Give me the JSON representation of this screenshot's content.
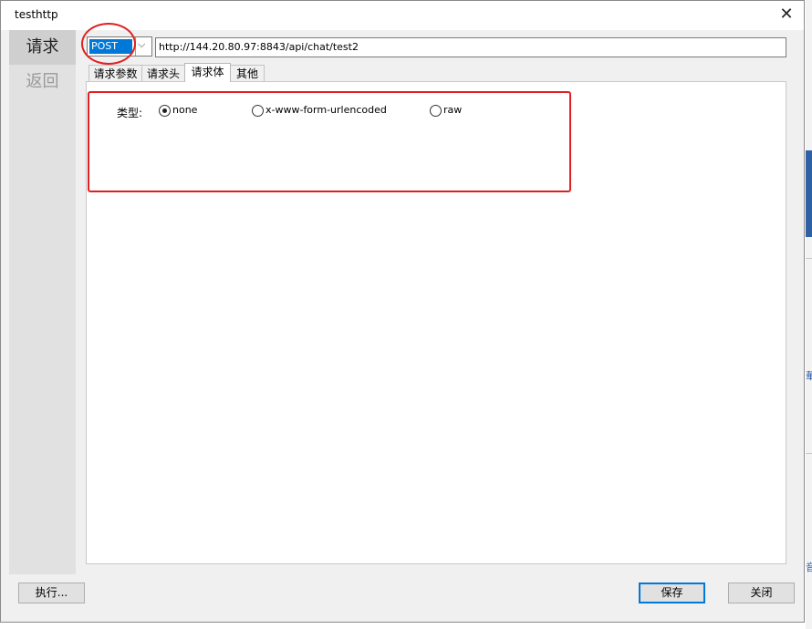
{
  "window": {
    "title": "testhttp",
    "close_glyph": "✕"
  },
  "sidebar": {
    "items": [
      {
        "label": "请求",
        "state": "selected"
      },
      {
        "label": "返回",
        "state": "disabled"
      }
    ]
  },
  "request": {
    "method": "POST",
    "dropdown_glyph": "⌵",
    "url": "http://144.20.80.97:8843/api/chat/test2"
  },
  "tabs": [
    {
      "label": "请求参数"
    },
    {
      "label": "请求头"
    },
    {
      "label": "请求体",
      "active": true
    },
    {
      "label": "其他"
    }
  ],
  "body": {
    "type_label": "类型:",
    "options": [
      {
        "label": "none",
        "checked": true
      },
      {
        "label": "x-www-form-urlencoded",
        "checked": false
      },
      {
        "label": "raw",
        "checked": false
      }
    ]
  },
  "footer": {
    "execute": "执行...",
    "save": "保存",
    "close": "关闭"
  },
  "background": {
    "glyphs": [
      "華",
      "音"
    ]
  },
  "colors": {
    "accent": "#0078d7",
    "annotation": "#e02020"
  }
}
